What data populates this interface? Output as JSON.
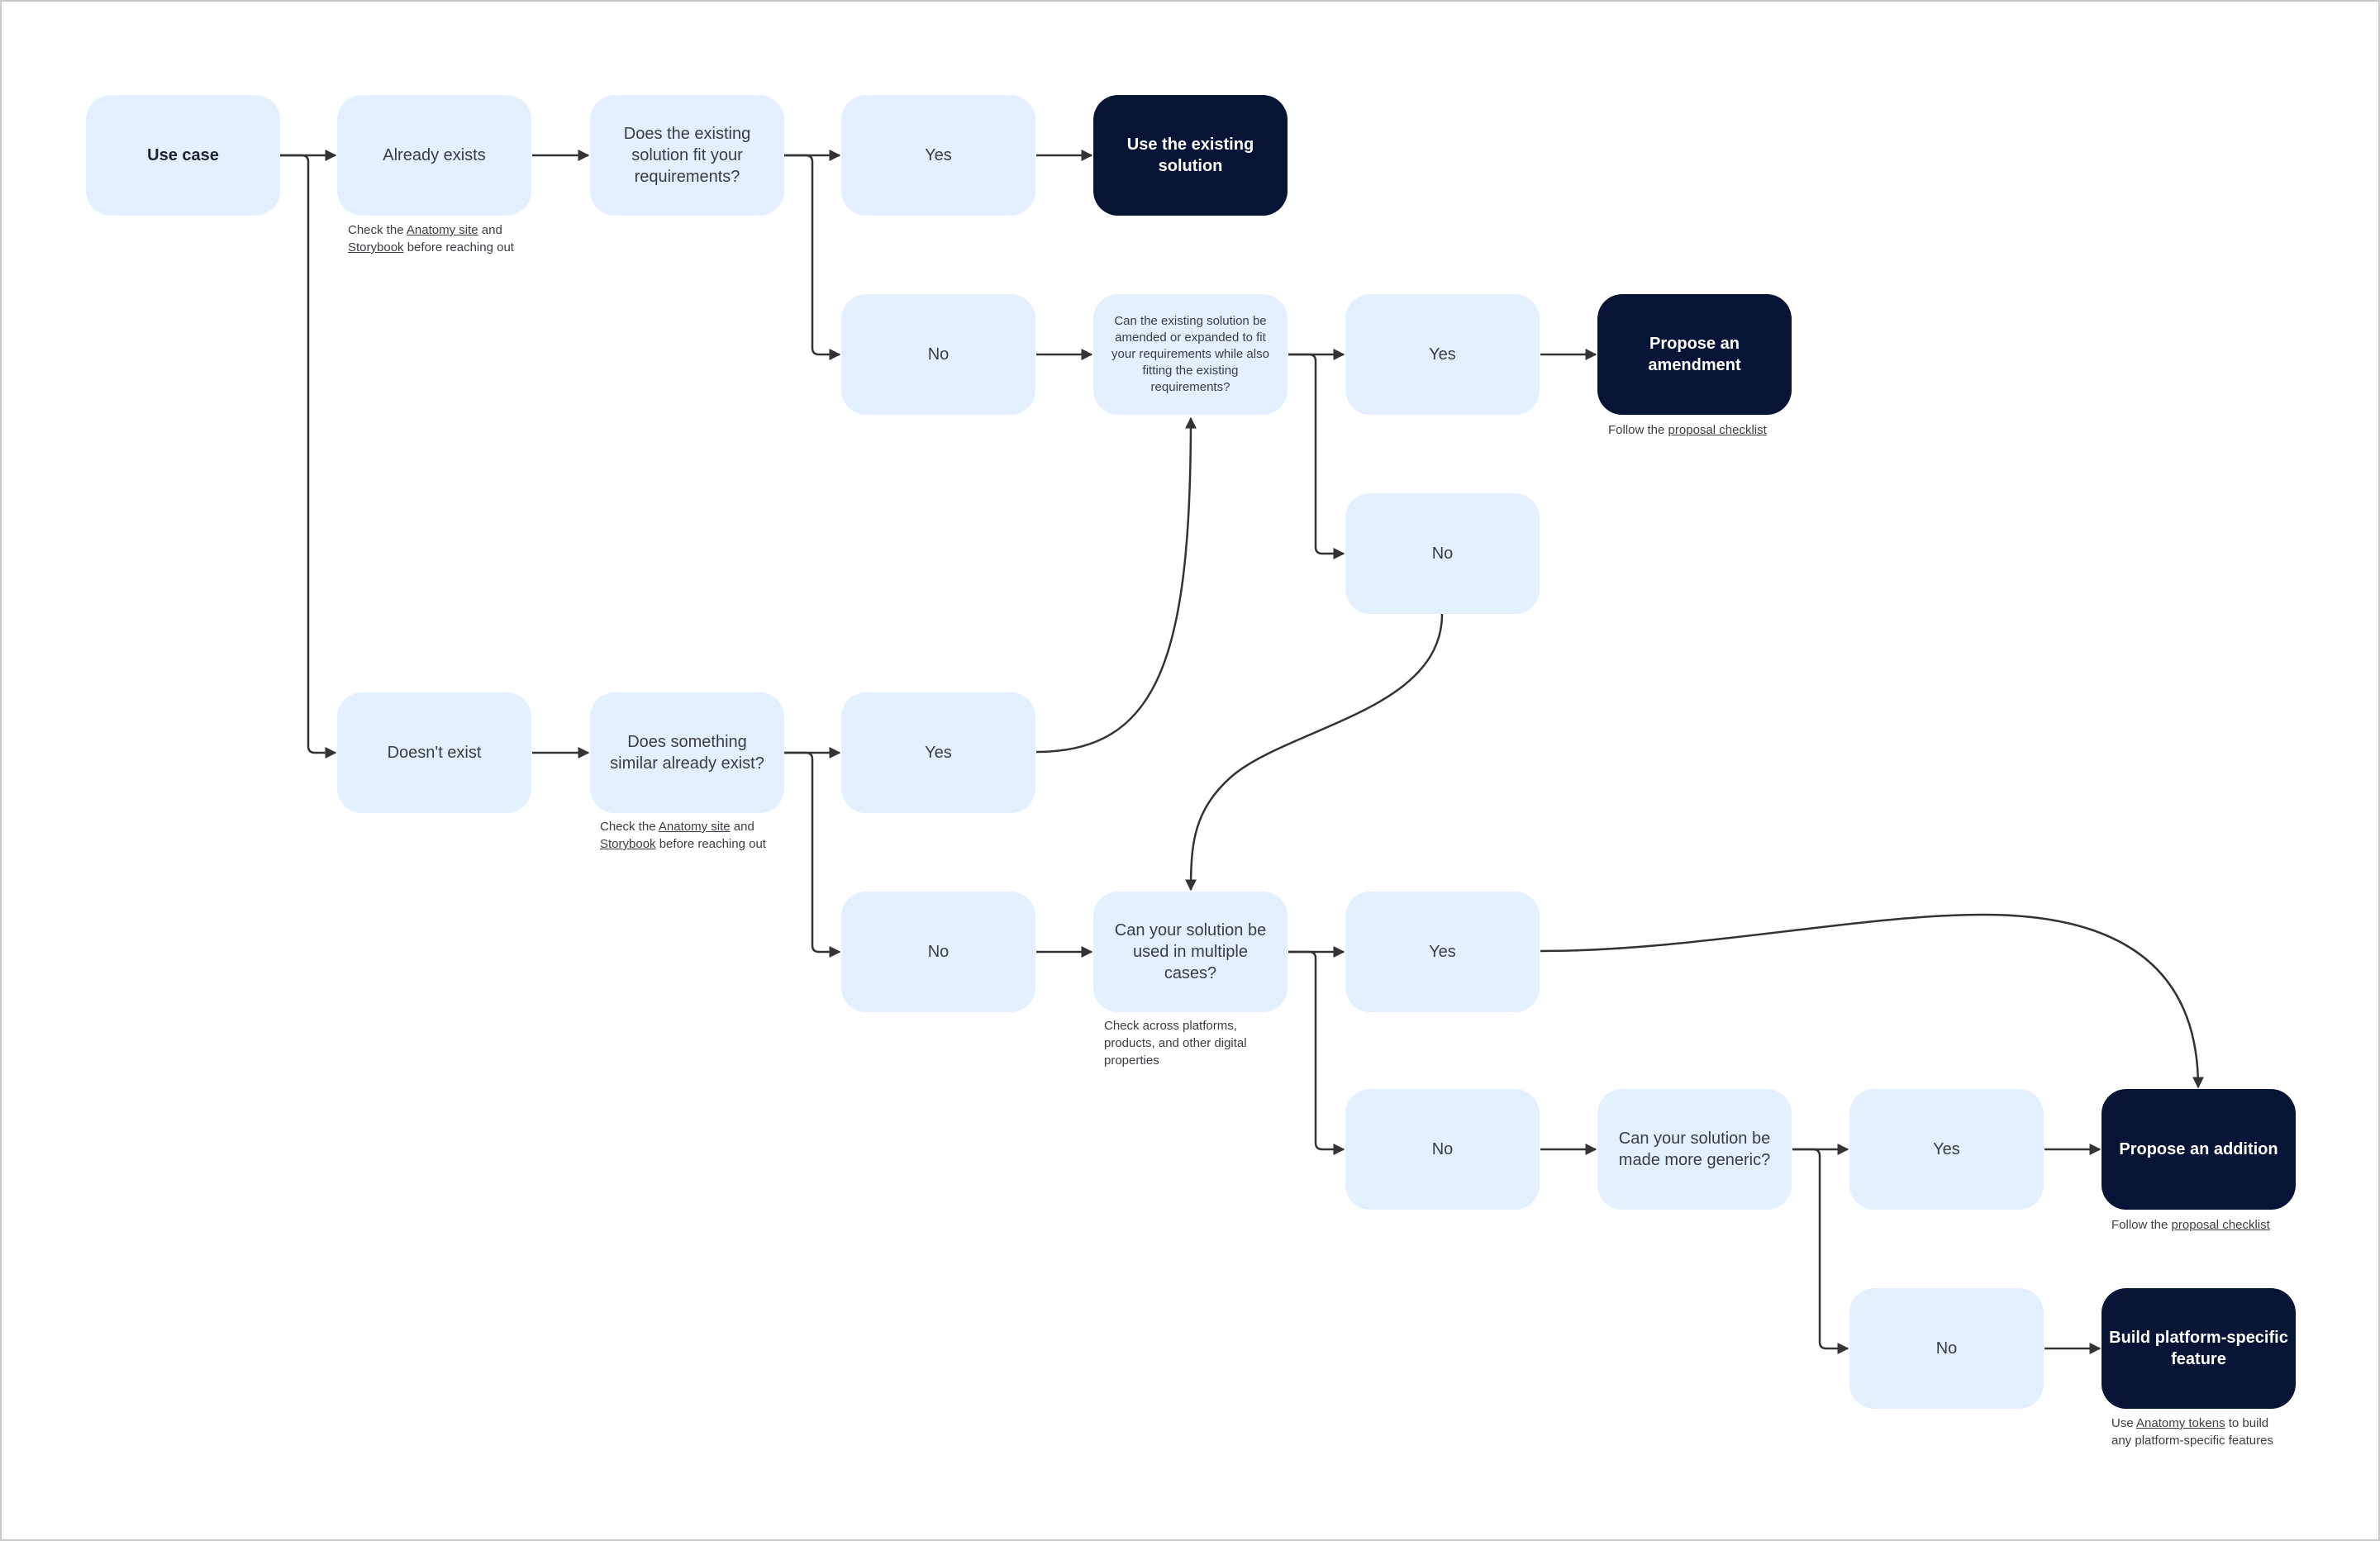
{
  "diagram": {
    "colors": {
      "node_light": "#e4efff",
      "node_dark": "#061535",
      "connector": "#333333",
      "text": "#3a3d42",
      "frame_border": "#c9c9c9"
    },
    "nodes": {
      "use_case": {
        "label": "Use case",
        "style": "start"
      },
      "already_exists": {
        "label": "Already exists",
        "style": "light"
      },
      "fit_requirements_q": {
        "label": "Does the existing solution fit your requirements?",
        "style": "light"
      },
      "fit_yes": {
        "label": "Yes",
        "style": "light"
      },
      "use_existing": {
        "label": "Use the existing solution",
        "style": "terminal"
      },
      "fit_no": {
        "label": "No",
        "style": "light"
      },
      "amend_q": {
        "label": "Can the existing solution be amended or expanded to fit your requirements while also fitting the existing requirements?",
        "style": "light"
      },
      "amend_yes": {
        "label": "Yes",
        "style": "light"
      },
      "propose_amendment": {
        "label": "Propose an amendment",
        "style": "terminal"
      },
      "amend_no": {
        "label": "No",
        "style": "light"
      },
      "doesnt_exist": {
        "label": "Doesn't exist",
        "style": "light"
      },
      "similar_q": {
        "label": "Does something similar already exist?",
        "style": "light"
      },
      "similar_yes": {
        "label": "Yes",
        "style": "light"
      },
      "similar_no": {
        "label": "No",
        "style": "light"
      },
      "multiple_cases_q": {
        "label": "Can your solution be used in multiple cases?",
        "style": "light"
      },
      "multiple_yes": {
        "label": "Yes",
        "style": "light"
      },
      "multiple_no": {
        "label": "No",
        "style": "light"
      },
      "generic_q": {
        "label": "Can your solution be made more generic?",
        "style": "light"
      },
      "generic_yes": {
        "label": "Yes",
        "style": "light"
      },
      "propose_addition": {
        "label": "Propose an addition",
        "style": "terminal"
      },
      "generic_no": {
        "label": "No",
        "style": "light"
      },
      "build_platform": {
        "label": "Build platform-specific feature",
        "style": "terminal"
      }
    },
    "notes": {
      "already_exists_note": {
        "line1_prefix": "Check the ",
        "line1_link": "Anatomy site",
        "line1_suffix": " and",
        "line2_link": "Storybook",
        "line2_suffix": " before reaching out"
      },
      "similar_note": {
        "line1_prefix": "Check the ",
        "line1_link": "Anatomy site",
        "line1_suffix": " and",
        "line2_link": "Storybook",
        "line2_suffix": " before reaching out"
      },
      "amendment_note": {
        "prefix": "Follow the ",
        "link": "proposal checklist"
      },
      "multiple_cases_note": {
        "line1": "Check across platforms,",
        "line2": "products, and other digital",
        "line3": "properties"
      },
      "addition_note": {
        "prefix": "Follow the ",
        "link": "proposal checklist"
      },
      "platform_note": {
        "line1_prefix": "Use ",
        "line1_link": "Anatomy tokens",
        "line1_suffix": " to build",
        "line2": "any platform-specific features"
      }
    },
    "edges": [
      {
        "from": "use_case",
        "to": "already_exists"
      },
      {
        "from": "use_case",
        "to": "doesnt_exist"
      },
      {
        "from": "already_exists",
        "to": "fit_requirements_q"
      },
      {
        "from": "fit_requirements_q",
        "to": "fit_yes"
      },
      {
        "from": "fit_requirements_q",
        "to": "fit_no"
      },
      {
        "from": "fit_yes",
        "to": "use_existing"
      },
      {
        "from": "fit_no",
        "to": "amend_q"
      },
      {
        "from": "amend_q",
        "to": "amend_yes"
      },
      {
        "from": "amend_q",
        "to": "amend_no"
      },
      {
        "from": "amend_yes",
        "to": "propose_amendment"
      },
      {
        "from": "amend_no",
        "to": "multiple_cases_q"
      },
      {
        "from": "doesnt_exist",
        "to": "similar_q"
      },
      {
        "from": "similar_q",
        "to": "similar_yes"
      },
      {
        "from": "similar_q",
        "to": "similar_no"
      },
      {
        "from": "similar_yes",
        "to": "amend_q"
      },
      {
        "from": "similar_no",
        "to": "multiple_cases_q"
      },
      {
        "from": "multiple_cases_q",
        "to": "multiple_yes"
      },
      {
        "from": "multiple_cases_q",
        "to": "multiple_no"
      },
      {
        "from": "multiple_yes",
        "to": "propose_addition"
      },
      {
        "from": "multiple_no",
        "to": "generic_q"
      },
      {
        "from": "generic_q",
        "to": "generic_yes"
      },
      {
        "from": "generic_q",
        "to": "generic_no"
      },
      {
        "from": "generic_yes",
        "to": "propose_addition"
      },
      {
        "from": "generic_no",
        "to": "build_platform"
      }
    ]
  }
}
